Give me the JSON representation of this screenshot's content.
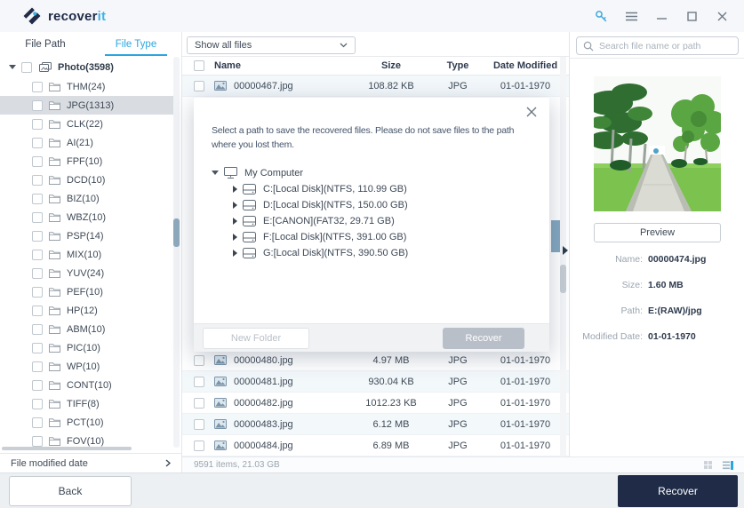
{
  "window": {
    "brand_1": "recover",
    "brand_2": "it"
  },
  "sidebar": {
    "tabs": [
      {
        "label": "File Path"
      },
      {
        "label": "File Type",
        "active": true
      }
    ],
    "root_label": "Photo(3598)",
    "items": [
      {
        "label": "THM(24)"
      },
      {
        "label": "JPG(1313)",
        "cls": "selected"
      },
      {
        "label": "CLK(22)"
      },
      {
        "label": "AI(21)"
      },
      {
        "label": "FPF(10)"
      },
      {
        "label": "DCD(10)"
      },
      {
        "label": "BIZ(10)"
      },
      {
        "label": "WBZ(10)"
      },
      {
        "label": "PSP(14)"
      },
      {
        "label": "MIX(10)"
      },
      {
        "label": "YUV(24)"
      },
      {
        "label": "PEF(10)"
      },
      {
        "label": "HP(12)"
      },
      {
        "label": "ABM(10)"
      },
      {
        "label": "PIC(10)"
      },
      {
        "label": "WP(10)"
      },
      {
        "label": "CONT(10)"
      },
      {
        "label": "TIFF(8)"
      },
      {
        "label": "PCT(10)"
      },
      {
        "label": "FOV(10)"
      }
    ],
    "footer_filter": "File modified date"
  },
  "toolbar": {
    "filter_value": "Show all files"
  },
  "search": {
    "placeholder": "Search file name or path"
  },
  "table": {
    "columns": [
      "Name",
      "Size",
      "Type",
      "Date Modified"
    ],
    "top_rows": [
      {
        "name": "00000467.jpg",
        "size": "108.82 KB",
        "type": "JPG",
        "date": "01-01-1970"
      }
    ],
    "bottom_rows": [
      {
        "name": "00000480.jpg",
        "size": "4.97 MB",
        "type": "JPG",
        "date": "01-01-1970"
      },
      {
        "name": "00000481.jpg",
        "size": "930.04 KB",
        "type": "JPG",
        "date": "01-01-1970"
      },
      {
        "name": "00000482.jpg",
        "size": "1012.23 KB",
        "type": "JPG",
        "date": "01-01-1970"
      },
      {
        "name": "00000483.jpg",
        "size": "6.12 MB",
        "type": "JPG",
        "date": "01-01-1970"
      },
      {
        "name": "00000484.jpg",
        "size": "6.89 MB",
        "type": "JPG",
        "date": "01-01-1970"
      }
    ],
    "status": "9591 items, 21.03 GB"
  },
  "dialog": {
    "message": "Select a path to save the recovered files. Please do not save files to the path where you lost them.",
    "computer_label": "My Computer",
    "drives": [
      "C:[Local Disk](NTFS, 110.99 GB)",
      "D:[Local Disk](NTFS, 150.00 GB)",
      "E:[CANON](FAT32, 29.71 GB)",
      "F:[Local Disk](NTFS, 391.00 GB)",
      "G:[Local Disk](NTFS, 390.50 GB)"
    ],
    "new_folder_label": "New Folder",
    "recover_label": "Recover"
  },
  "preview": {
    "button_label": "Preview",
    "details": [
      {
        "label": "Name:",
        "value": "00000474.jpg"
      },
      {
        "label": "Size:",
        "value": "1.60 MB"
      },
      {
        "label": "Path:",
        "value": "E:(RAW)/jpg"
      },
      {
        "label": "Modified Date:",
        "value": "01-01-1970"
      }
    ]
  },
  "footer": {
    "back_label": "Back",
    "recover_label": "Recover"
  },
  "icons": {
    "titlebar": [
      "key-icon",
      "menu-icon",
      "minimize-icon",
      "maximize-icon",
      "close-icon"
    ],
    "search": "search-icon",
    "view_toggles": [
      "grid-view-icon",
      "list-view-icon"
    ]
  },
  "colors": {
    "accent": "#2ba5e0",
    "navy": "#1f2b47",
    "selected_row_edge": "#84a7c0",
    "alt_row": "#f3f8fb"
  }
}
